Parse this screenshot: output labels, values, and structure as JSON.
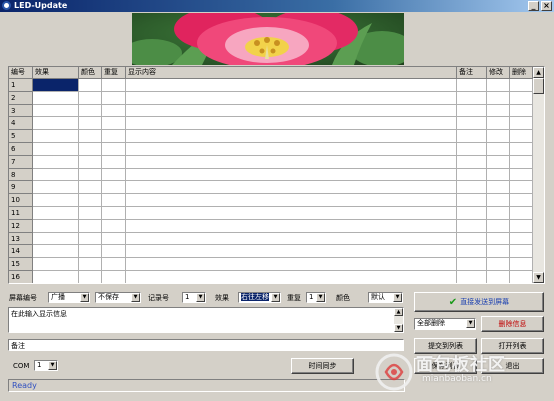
{
  "window": {
    "title": "LED-Update",
    "min_label": "_",
    "close_label": "×"
  },
  "grid": {
    "columns": [
      "编号",
      "效果",
      "颜色",
      "重复",
      "显示内容",
      "备注",
      "修改",
      "删除"
    ],
    "row_numbers": [
      "1",
      "2",
      "3",
      "4",
      "5",
      "6",
      "7",
      "8",
      "9",
      "10",
      "11",
      "12",
      "13",
      "14",
      "15",
      "16"
    ],
    "scroll_up": "▲",
    "scroll_down": "▼"
  },
  "form": {
    "screen_label": "屏幕编号",
    "screen_value": "广播",
    "save_value": "不保存",
    "record_label": "记录号",
    "record_value": "1",
    "effect_label": "效果",
    "effect_value": "右往左移",
    "repeat_label": "重复",
    "repeat_value": "1",
    "color_label": "颜色",
    "color_value": "默认",
    "content_text": "在此输入显示信息",
    "remark_text": "备注",
    "com_label": "COM",
    "com_value": "1",
    "arrow": "▼",
    "tb_up": "▲",
    "tb_down": "▼"
  },
  "buttons": {
    "send_direct": "直接发送到屏幕",
    "delete_scope": "全部删除",
    "delete_info": "删除信息",
    "submit_list": "提交到列表",
    "open_list": "打开列表",
    "time_sync": "时间同步",
    "save_list": "保存列表",
    "exit": "退出"
  },
  "status": {
    "text": "Ready"
  },
  "watermark": {
    "main": "面包板社区",
    "sub": "mianbaoban.cn"
  },
  "colors": {
    "title_start": "#0a246a",
    "selection": "#0a246a",
    "send_icon": "#1a9a1a",
    "delete_text": "#c00000",
    "status_text": "#3050c0"
  }
}
